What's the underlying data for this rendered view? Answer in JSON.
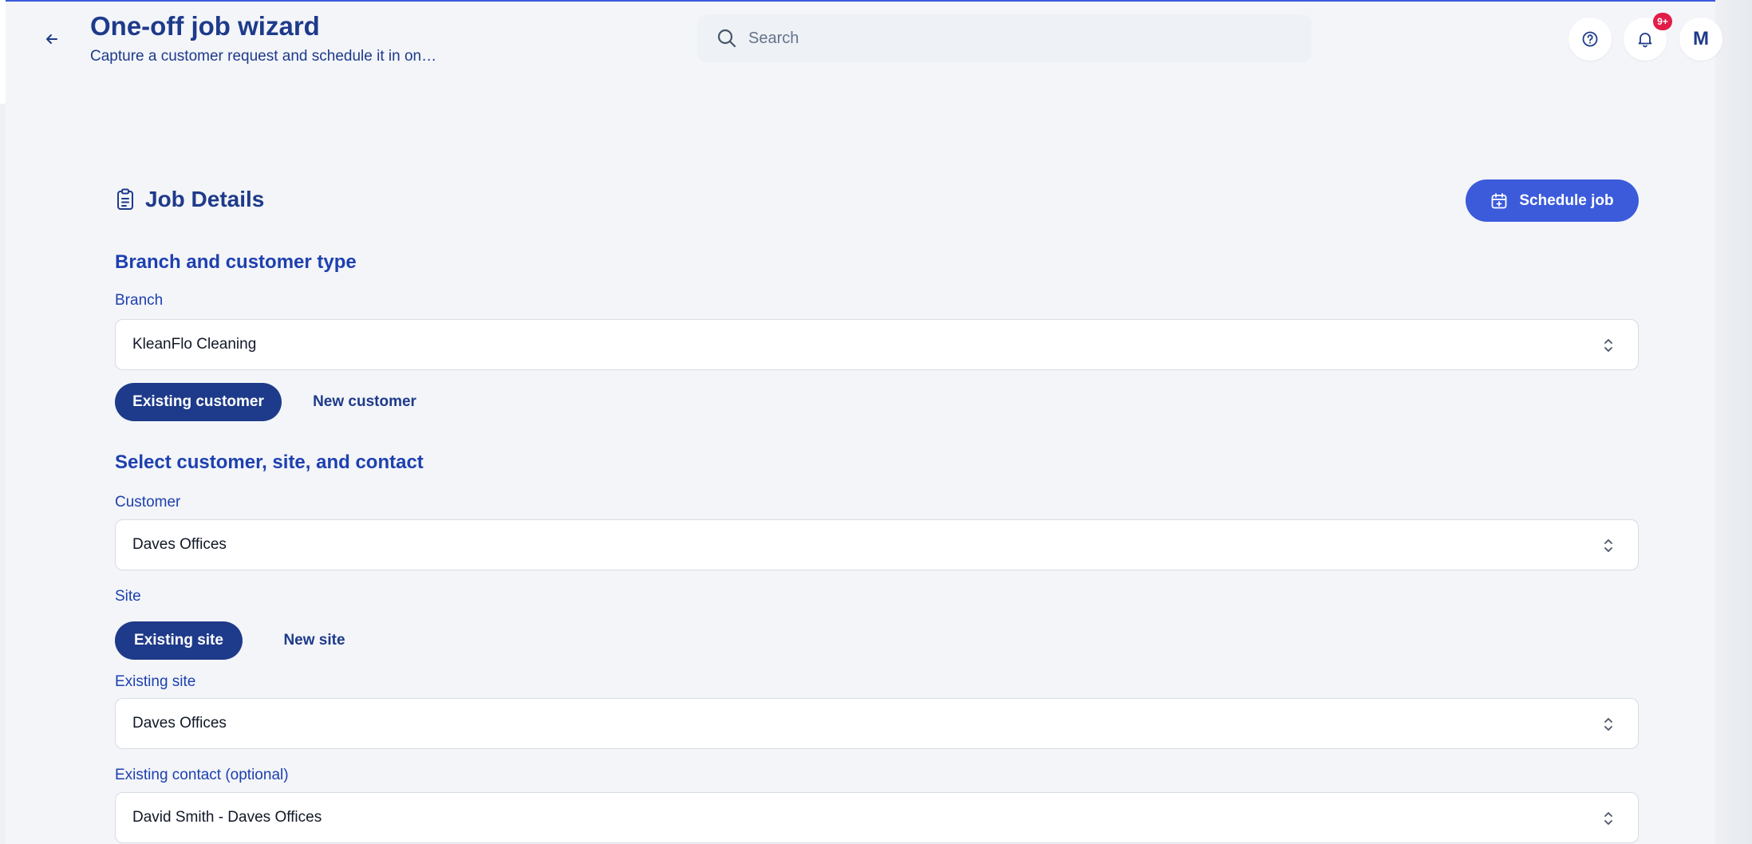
{
  "header": {
    "title": "One-off job wizard",
    "subtitle": "Capture a customer request and schedule it in on…",
    "search_placeholder": "Search",
    "notification_badge": "9+",
    "avatar_initial": "M"
  },
  "job_details": {
    "title": "Job Details",
    "schedule_button": "Schedule job"
  },
  "branch_section": {
    "heading": "Branch and customer type",
    "branch_label": "Branch",
    "branch_value": "KleanFlo Cleaning",
    "toggle_existing": "Existing customer",
    "toggle_new": "New customer",
    "selected": "Existing customer"
  },
  "customer_section": {
    "heading": "Select customer, site, and contact",
    "customer_label": "Customer",
    "customer_value": "Daves Offices",
    "site_label": "Site",
    "site_toggle_existing": "Existing site",
    "site_toggle_new": "New site",
    "site_selected": "Existing site",
    "existing_site_label": "Existing site",
    "existing_site_value": "Daves Offices",
    "contact_label": "Existing contact (optional)",
    "contact_value": "David Smith - Daves Offices"
  },
  "colors": {
    "primary": "#1e3a8a",
    "accent": "#3b5bdb",
    "badge": "#e11d48",
    "background": "#f3f5f9"
  }
}
